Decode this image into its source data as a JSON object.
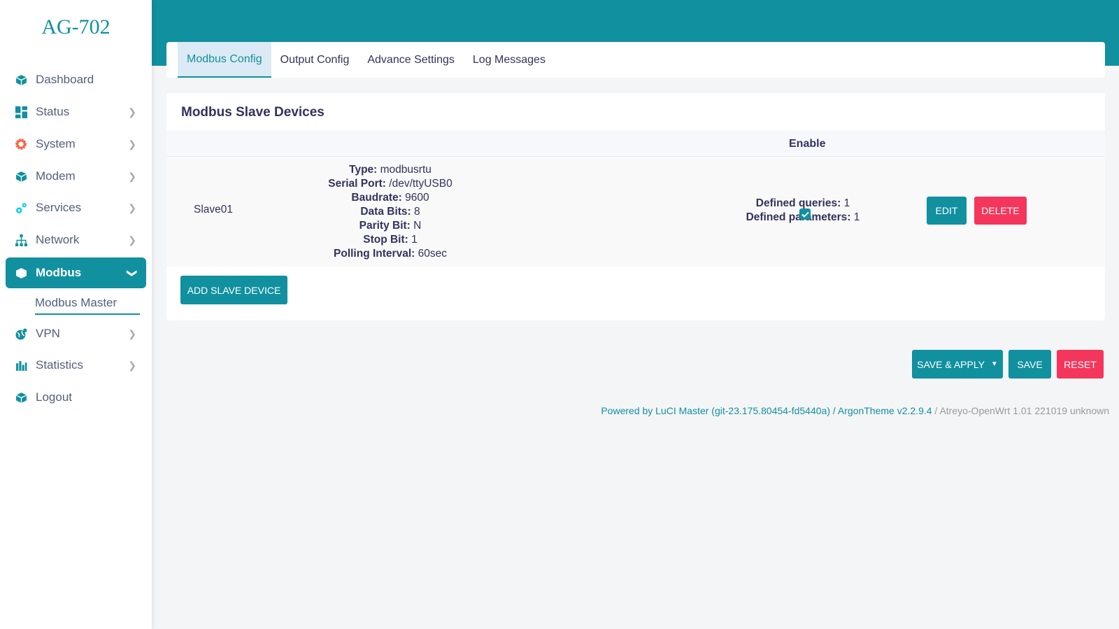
{
  "brand": "AG-702",
  "colors": {
    "accent": "#11909f",
    "danger": "#f5365c",
    "system_icon": "#fb6340"
  },
  "sidebar": {
    "items": [
      {
        "label": "Dashboard",
        "icon": "cube-icon"
      },
      {
        "label": "Status",
        "icon": "grid-icon"
      },
      {
        "label": "System",
        "icon": "gear-icon"
      },
      {
        "label": "Modem",
        "icon": "cube-icon"
      },
      {
        "label": "Services",
        "icon": "cogs-icon"
      },
      {
        "label": "Network",
        "icon": "sitemap-icon"
      },
      {
        "label": "Modbus",
        "icon": "cube-icon",
        "active": true
      },
      {
        "label": "VPN",
        "icon": "globe-icon"
      },
      {
        "label": "Statistics",
        "icon": "bar-chart-icon"
      },
      {
        "label": "Logout",
        "icon": "cube-icon"
      }
    ],
    "subitem": "Modbus Master"
  },
  "tabs": [
    "Modbus Config",
    "Output Config",
    "Advance Settings",
    "Log Messages"
  ],
  "section": {
    "title": "Modbus Slave Devices",
    "header_enable": "Enable",
    "rows": [
      {
        "name": "Slave01",
        "details": [
          [
            "Type:",
            "modbusrtu"
          ],
          [
            "Serial Port:",
            "/dev/ttyUSB0"
          ],
          [
            "Baudrate:",
            "9600"
          ],
          [
            "Data Bits:",
            "8"
          ],
          [
            "Parity Bit:",
            "N"
          ],
          [
            "Stop Bit:",
            "1"
          ],
          [
            "Polling Interval:",
            "60sec"
          ]
        ],
        "queries": [
          [
            "Defined queries:",
            "1"
          ],
          [
            "Defined parameters:",
            "1"
          ]
        ],
        "enabled": true,
        "edit": "EDIT",
        "delete": "DELETE"
      }
    ],
    "add_button": "ADD SLAVE DEVICE"
  },
  "actions": {
    "save_apply": "SAVE & APPLY",
    "save": "SAVE",
    "reset": "RESET"
  },
  "footer": {
    "luci": "Powered by LuCI Master (git-23.175.80454-fd5440a)",
    "sep1": " / ",
    "theme": "ArgonTheme v2.2.9.4",
    "sep2": " / ",
    "build": "Atreyo-OpenWrt 1.01 221019 unknown"
  }
}
